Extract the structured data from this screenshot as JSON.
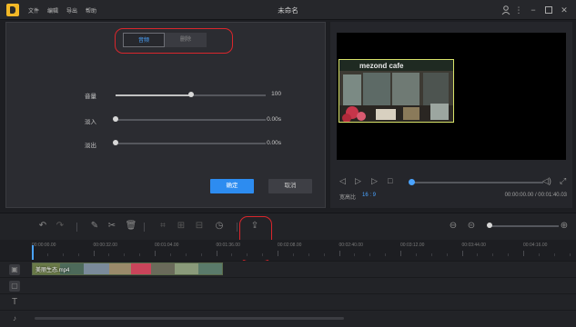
{
  "window": {
    "title": "未命名",
    "menu": [
      "文件",
      "编辑",
      "导出",
      "帮助"
    ],
    "controls": [
      "user-icon",
      "more-icon",
      "minimize-icon",
      "maximize-icon",
      "close-icon"
    ]
  },
  "audio_panel": {
    "tabs": [
      {
        "label": "音频",
        "active": true
      },
      {
        "label": "删除",
        "active": false
      }
    ],
    "rows": [
      {
        "label": "音量",
        "value": "100",
        "level": 0.5
      },
      {
        "label": "淡入",
        "value": "0.00s",
        "level": 0
      },
      {
        "label": "淡出",
        "value": "0.00s",
        "level": 0
      }
    ],
    "confirm_label": "确定",
    "cancel_label": "取消"
  },
  "preview": {
    "aspect_label": "宽高比",
    "aspect_value": "16 : 9",
    "time": "00:00:00.00 / 00:01:40.03",
    "progress": 0,
    "sign_text": "mezond cafe"
  },
  "toolbar": {
    "export_tooltip": "导出",
    "zoom_level": 0.02
  },
  "timeline": {
    "ticks": [
      "00:00:00.00",
      "00:00:32.00",
      "00:01:04.00",
      "00:01:36.00",
      "00:02:08.00",
      "00:02:40.00",
      "00:03:12.00",
      "00:03:44.00",
      "00:04:16.00"
    ],
    "clip_name": "美丽生态.mp4"
  },
  "colors": {
    "accent": "#2d8cf0",
    "callout": "#d9262c"
  }
}
